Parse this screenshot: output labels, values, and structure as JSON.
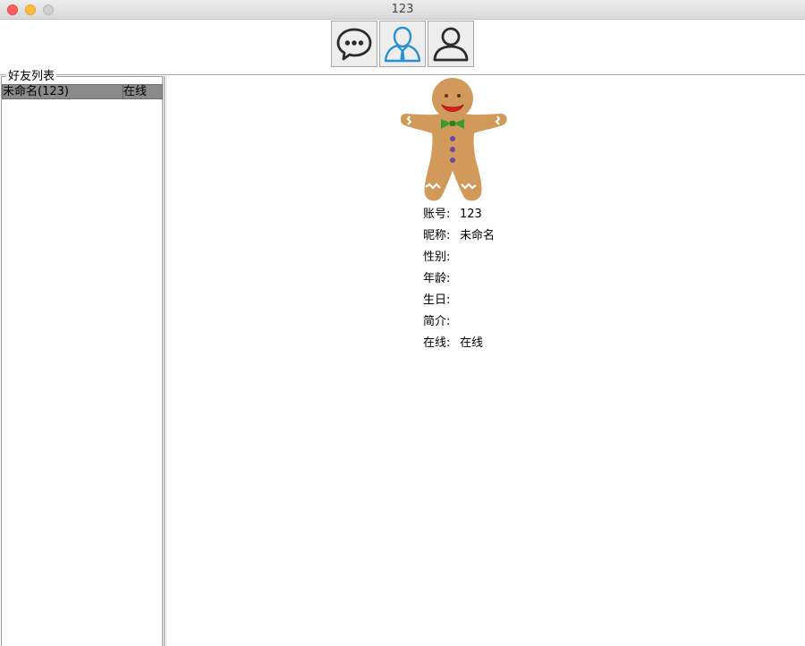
{
  "window": {
    "title": "123"
  },
  "toolbar": {
    "buttons": [
      {
        "icon": "chat-bubble-icon"
      },
      {
        "icon": "friends-contact-icon",
        "color": "#2a8fd0"
      },
      {
        "icon": "profile-person-icon"
      }
    ]
  },
  "sidebar": {
    "group_title": "好友列表",
    "friends": [
      {
        "name": "未命名(123)",
        "status": "在线"
      }
    ]
  },
  "profile": {
    "avatar_icon": "gingerbread-man-avatar",
    "fields": [
      {
        "label": "账号:",
        "value": "123"
      },
      {
        "label": "昵称:",
        "value": "未命名"
      },
      {
        "label": "性别:",
        "value": ""
      },
      {
        "label": "年龄:",
        "value": ""
      },
      {
        "label": "生日:",
        "value": ""
      },
      {
        "label": "简介:",
        "value": ""
      },
      {
        "label": "在线:",
        "value": "在线"
      }
    ]
  },
  "colors": {
    "selected_row": "#8a8a8a",
    "accent_blue": "#2a8fd0",
    "gingerbread": "#d19a5a"
  }
}
